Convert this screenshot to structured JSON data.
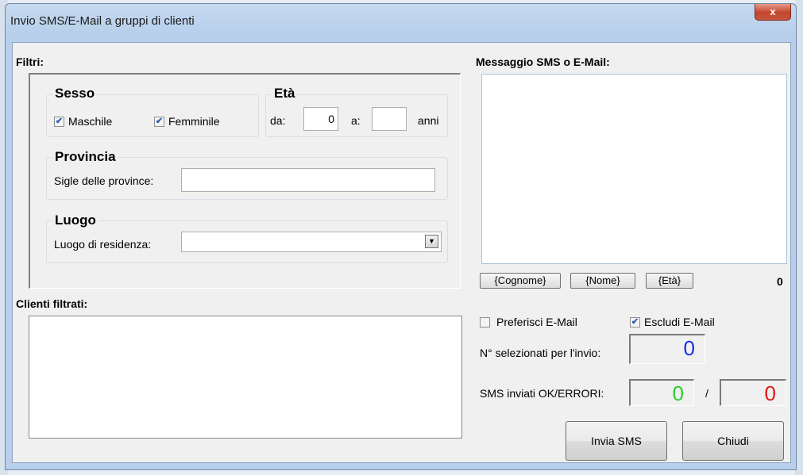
{
  "window": {
    "title": "Invio SMS/E-Mail a gruppi di clienti",
    "close_label": "x"
  },
  "filters": {
    "heading": "Filtri:",
    "sesso": {
      "title": "Sesso",
      "maschile": {
        "label": "Maschile",
        "checked": true
      },
      "femminile": {
        "label": "Femminile",
        "checked": true
      }
    },
    "eta": {
      "title": "Età",
      "from_label": "da:",
      "from_value": "0",
      "to_label": "a:",
      "to_value": "",
      "unit": "anni"
    },
    "provincia": {
      "title": "Provincia",
      "label": "Sigle delle province:",
      "value": ""
    },
    "luogo": {
      "title": "Luogo",
      "label": "Luogo di residenza:",
      "value": ""
    }
  },
  "clients": {
    "heading": "Clienti filtrati:",
    "items": []
  },
  "message": {
    "heading": "Messaggio SMS o E-Mail:",
    "value": "",
    "tags": [
      "{Cognome}",
      "{Nome}",
      "{Età}"
    ],
    "char_count": "0"
  },
  "options": {
    "prefer_email": {
      "label": "Preferisci E-Mail",
      "checked": false
    },
    "exclude_email": {
      "label": "Escludi E-Mail",
      "checked": true
    }
  },
  "stats": {
    "selected_label": "N° selezionati per l'invio:",
    "selected_value": "0",
    "sent_label": "SMS inviati OK/ERRORI:",
    "ok_value": "0",
    "separator": "/",
    "error_value": "0",
    "colors": {
      "selected": "#1a2ee0",
      "ok": "#2ecc2e",
      "error": "#e01818"
    }
  },
  "buttons": {
    "send": "Invia SMS",
    "close": "Chiudi"
  }
}
